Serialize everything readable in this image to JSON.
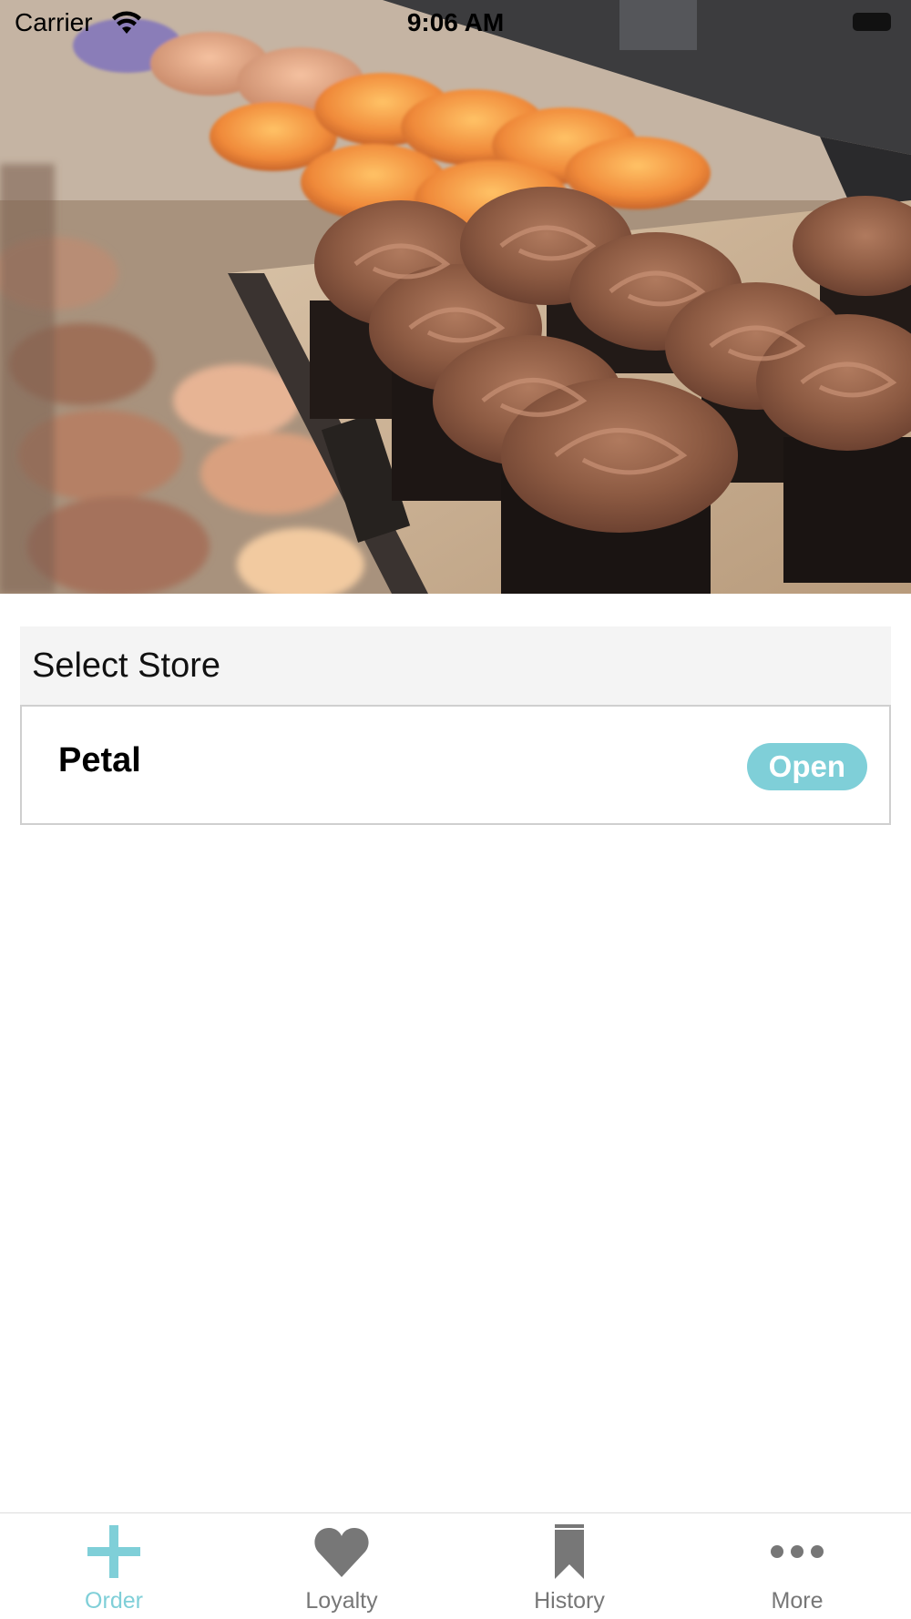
{
  "status_bar": {
    "carrier": "Carrier",
    "time": "9:06 AM"
  },
  "hero": {
    "icon": "cupcakes-photo"
  },
  "store_section": {
    "header": "Select Store",
    "stores": [
      {
        "name": "Petal",
        "status": "Open",
        "status_color": "#7fcfd8"
      }
    ]
  },
  "tab_bar": {
    "tabs": [
      {
        "label": "Order",
        "icon": "plus-icon",
        "active": true
      },
      {
        "label": "Loyalty",
        "icon": "heart-icon",
        "active": false
      },
      {
        "label": "History",
        "icon": "bookmark-icon",
        "active": false
      },
      {
        "label": "More",
        "icon": "more-dots-icon",
        "active": false
      }
    ],
    "active_color": "#7fcfd8",
    "inactive_color": "#777777"
  }
}
